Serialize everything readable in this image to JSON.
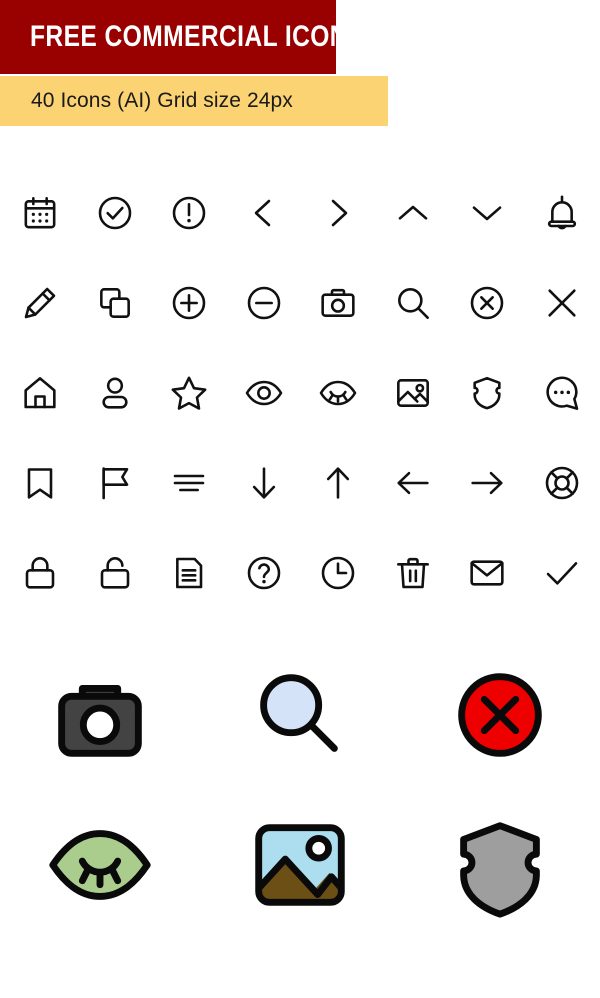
{
  "header": {
    "title": "FREE COMMERCIAL ICONS",
    "subtitle": "40 Icons (AI) Grid size 24px",
    "banner_color": "#990000",
    "subtitle_bg_color": "#fbd373",
    "title_color": "#ffffff",
    "subtitle_color": "#1a1a1a"
  },
  "meta": {
    "icon_count": "40",
    "format": "AI",
    "grid_size": "24px",
    "stroke_color": "#111111",
    "background": "#ffffff"
  },
  "icon_grid": {
    "rows": 5,
    "columns": 8,
    "icons": [
      [
        {
          "name": "calendar-icon",
          "label": "Calendar"
        },
        {
          "name": "check-circle-icon",
          "label": "Check circle"
        },
        {
          "name": "alert-circle-icon",
          "label": "Alert circle"
        },
        {
          "name": "chevron-left-icon",
          "label": "Chevron left"
        },
        {
          "name": "chevron-right-icon",
          "label": "Chevron right"
        },
        {
          "name": "chevron-up-icon",
          "label": "Chevron up"
        },
        {
          "name": "chevron-down-icon",
          "label": "Chevron down"
        },
        {
          "name": "bell-icon",
          "label": "Bell"
        }
      ],
      [
        {
          "name": "pencil-icon",
          "label": "Pencil"
        },
        {
          "name": "copy-icon",
          "label": "Copy"
        },
        {
          "name": "plus-circle-icon",
          "label": "Plus circle"
        },
        {
          "name": "minus-circle-icon",
          "label": "Minus circle"
        },
        {
          "name": "camera-icon",
          "label": "Camera"
        },
        {
          "name": "search-icon",
          "label": "Search"
        },
        {
          "name": "x-circle-icon",
          "label": "Close circle"
        },
        {
          "name": "close-icon",
          "label": "Close"
        }
      ],
      [
        {
          "name": "home-icon",
          "label": "Home"
        },
        {
          "name": "user-icon",
          "label": "User"
        },
        {
          "name": "star-icon",
          "label": "Star"
        },
        {
          "name": "eye-icon",
          "label": "Eye"
        },
        {
          "name": "eye-off-icon",
          "label": "Eye closed"
        },
        {
          "name": "image-icon",
          "label": "Image"
        },
        {
          "name": "shield-icon",
          "label": "Shield"
        },
        {
          "name": "chat-bubble-icon",
          "label": "Chat bubble"
        }
      ],
      [
        {
          "name": "bookmark-icon",
          "label": "Bookmark"
        },
        {
          "name": "flag-icon",
          "label": "Flag"
        },
        {
          "name": "sort-lines-icon",
          "label": "Sort lines"
        },
        {
          "name": "arrow-down-icon",
          "label": "Arrow down"
        },
        {
          "name": "arrow-up-icon",
          "label": "Arrow up"
        },
        {
          "name": "arrow-left-icon",
          "label": "Arrow left"
        },
        {
          "name": "arrow-right-icon",
          "label": "Arrow right"
        },
        {
          "name": "lifebuoy-icon",
          "label": "Lifebuoy"
        }
      ],
      [
        {
          "name": "lock-icon",
          "label": "Lock"
        },
        {
          "name": "unlock-icon",
          "label": "Unlock"
        },
        {
          "name": "document-icon",
          "label": "Document"
        },
        {
          "name": "help-circle-icon",
          "label": "Help circle"
        },
        {
          "name": "clock-icon",
          "label": "Clock"
        },
        {
          "name": "trash-icon",
          "label": "Trash"
        },
        {
          "name": "mail-icon",
          "label": "Mail"
        },
        {
          "name": "checkmark-icon",
          "label": "Checkmark"
        }
      ]
    ]
  },
  "featured_icons": {
    "rows": 2,
    "columns": 3,
    "items": [
      [
        {
          "name": "camera-filled-icon",
          "label": "Camera",
          "fill": "#434343",
          "accent": "#ffffff"
        },
        {
          "name": "search-filled-icon",
          "label": "Search",
          "fill": "#d4e3f7",
          "accent": "#0a0a0a"
        },
        {
          "name": "x-circle-filled-icon",
          "label": "Close circle",
          "fill": "#ee0000",
          "accent": "#0a0a0a"
        }
      ],
      [
        {
          "name": "eye-off-filled-icon",
          "label": "Eye closed",
          "fill": "#aacd8e",
          "accent": "#0a0a0a"
        },
        {
          "name": "image-filled-icon",
          "label": "Image",
          "fill": "#addef0",
          "accent": "#6b4f15"
        },
        {
          "name": "shield-filled-icon",
          "label": "Shield",
          "fill": "#9e9e9e",
          "accent": "#0a0a0a"
        }
      ]
    ]
  }
}
